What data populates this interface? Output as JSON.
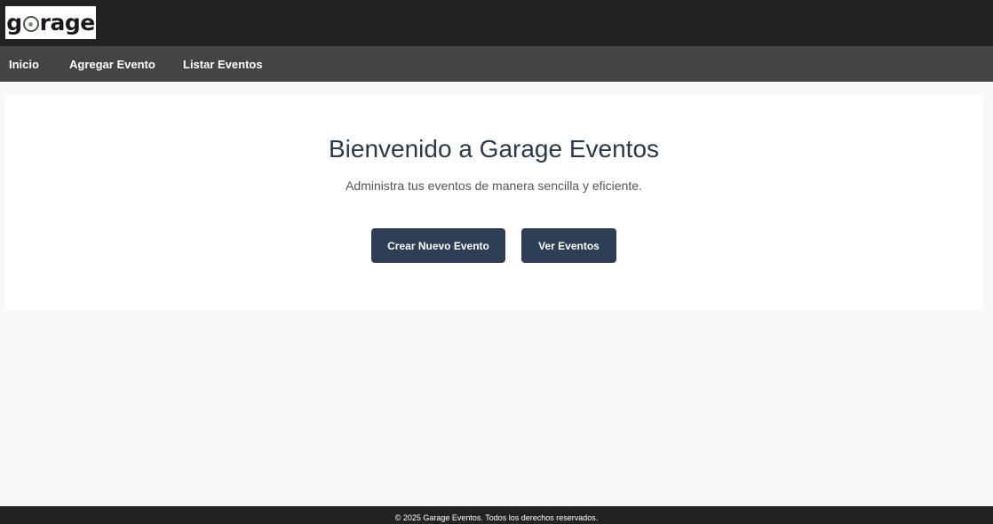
{
  "header": {
    "logo": {
      "part1": "g",
      "part2": "rage"
    }
  },
  "nav": {
    "items": [
      {
        "label": "Inicio"
      },
      {
        "label": "Agregar Evento"
      },
      {
        "label": "Listar Eventos"
      }
    ]
  },
  "hero": {
    "title": "Bienvenido a Garage Eventos",
    "subtitle": "Administra tus eventos de manera sencilla y eficiente.",
    "buttons": {
      "create": "Crear Nuevo Evento",
      "view": "Ver Eventos"
    }
  },
  "footer": {
    "text": "© 2025 Garage Eventos. Todos los derechos reservados."
  },
  "colors": {
    "topbar": "#222222",
    "navbar": "#444444",
    "button": "#2e3e55",
    "title": "#2b3a4a",
    "background": "#f8f8f8"
  }
}
